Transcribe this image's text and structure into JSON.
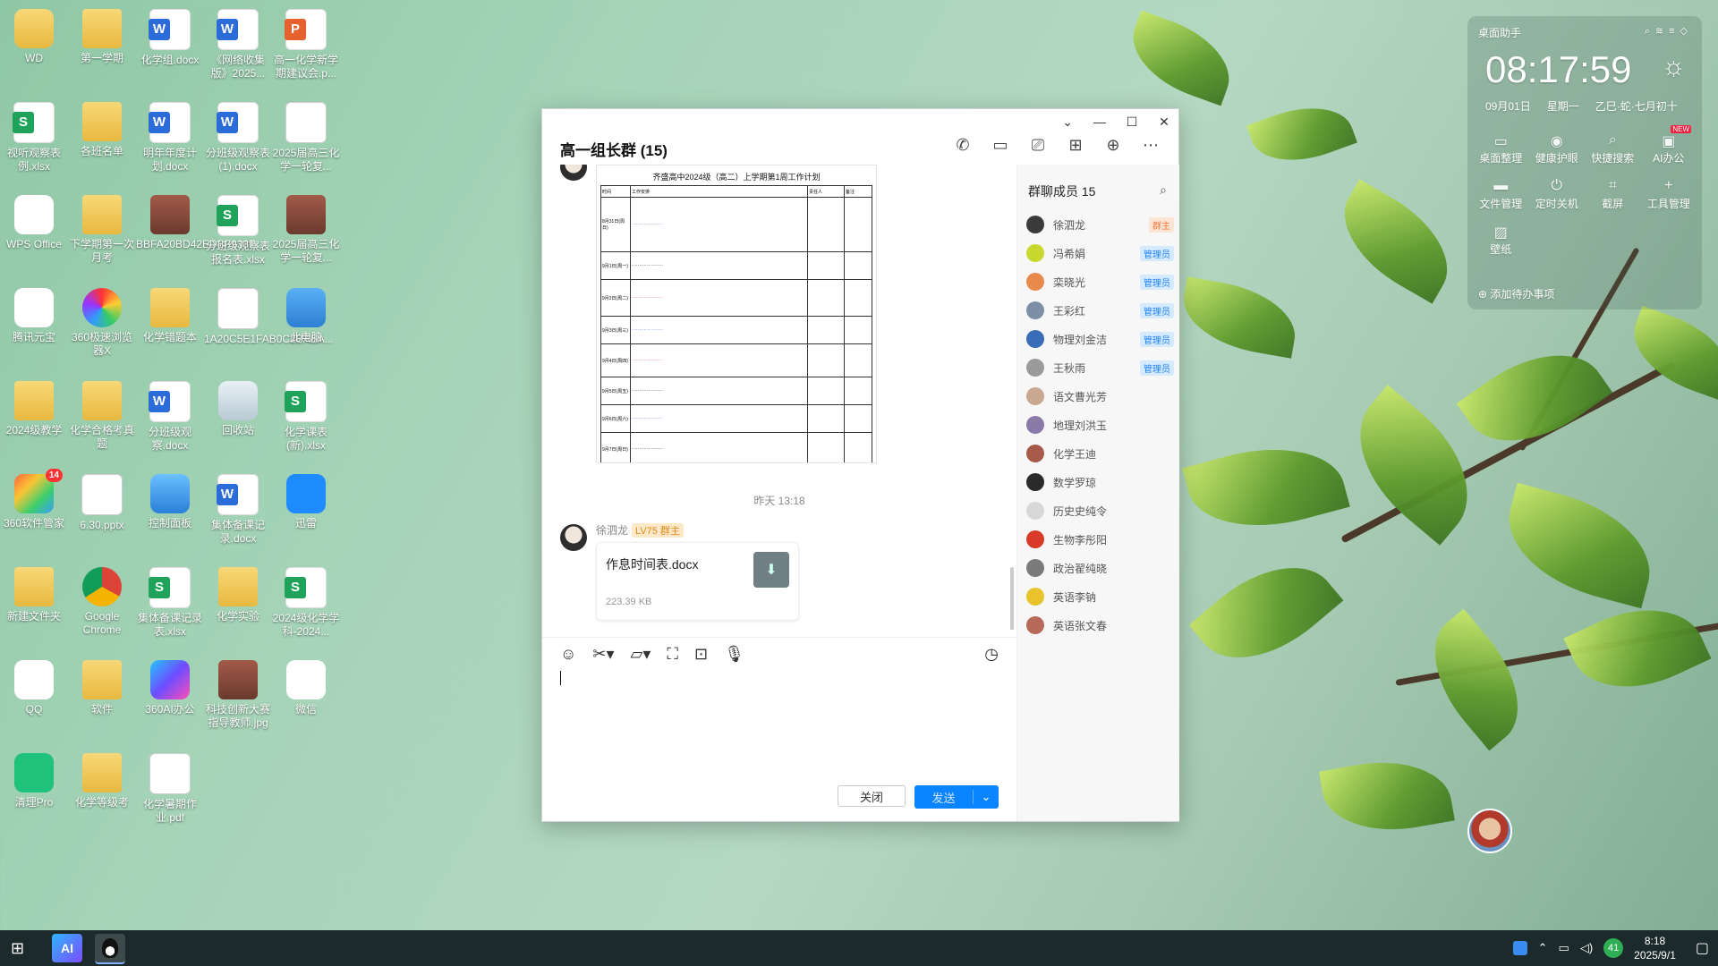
{
  "desktop": {
    "icons": [
      {
        "label": "WD",
        "kind": "user"
      },
      {
        "label": "第一学期",
        "kind": "folder"
      },
      {
        "label": "化学组.docx",
        "kind": "word"
      },
      {
        "label": "《网络收集版》2025...",
        "kind": "word"
      },
      {
        "label": "高一化学新学期建议会.p...",
        "kind": "ppt"
      },
      {
        "label": "视听观察表例.xlsx",
        "kind": "excel"
      },
      {
        "label": "各班名单",
        "kind": "folder"
      },
      {
        "label": "明年年度计划.docx",
        "kind": "word"
      },
      {
        "label": "分班级观察表(1).docx",
        "kind": "word"
      },
      {
        "label": "2025届高三化学一轮复...",
        "kind": "doc"
      },
      {
        "label": "WPS Office",
        "kind": "wps"
      },
      {
        "label": "下学期第一次月考",
        "kind": "folder"
      },
      {
        "label": "BBFA20BD42EDBF933F...",
        "kind": "img"
      },
      {
        "label": "分班级观察表报名表.xlsx",
        "kind": "excel"
      },
      {
        "label": "2025届高三化学一轮复...",
        "kind": "img"
      },
      {
        "label": "腾讯元宝",
        "kind": "yuanbao"
      },
      {
        "label": "360极速浏览器X",
        "kind": "browser360"
      },
      {
        "label": "化学错题本",
        "kind": "folder"
      },
      {
        "label": "1A20C5E1FAB0C2BAEA...",
        "kind": "doc"
      },
      {
        "label": "此电脑",
        "kind": "pc"
      },
      {
        "label": "2024级教学",
        "kind": "folder"
      },
      {
        "label": "化学合格考真题",
        "kind": "folder"
      },
      {
        "label": "分班级观察.docx",
        "kind": "word"
      },
      {
        "label": "回收站",
        "kind": "recycle"
      },
      {
        "label": "化学课表(新).xlsx",
        "kind": "excel"
      },
      {
        "label": "360软件管家",
        "kind": "soft360",
        "badge": "14"
      },
      {
        "label": "6.30.pptx",
        "kind": "doc"
      },
      {
        "label": "控制面板",
        "kind": "control"
      },
      {
        "label": "集体备课记录.docx",
        "kind": "word"
      },
      {
        "label": "迅雷",
        "kind": "xunlei"
      },
      {
        "label": "新建文件夹",
        "kind": "folder"
      },
      {
        "label": "Google Chrome",
        "kind": "chrome"
      },
      {
        "label": "集体备课记录表.xlsx",
        "kind": "excel"
      },
      {
        "label": "化学实验",
        "kind": "folder"
      },
      {
        "label": "2024级化学学科-2024...",
        "kind": "excel"
      },
      {
        "label": "QQ",
        "kind": "qq"
      },
      {
        "label": "软件",
        "kind": "folder"
      },
      {
        "label": "360AI办公",
        "kind": "ai360"
      },
      {
        "label": "科技创新大赛指导教师.jpg",
        "kind": "img"
      },
      {
        "label": "微信",
        "kind": "wechat"
      },
      {
        "label": "清理Pro",
        "kind": "cleanpro"
      },
      {
        "label": "化学等级考",
        "kind": "folder"
      },
      {
        "label": "化学暑期作业.pdf",
        "kind": "doc"
      }
    ]
  },
  "chat": {
    "window_controls": [
      "⌄",
      "—",
      "☐",
      "✕"
    ],
    "title": "高一组长群 (15)",
    "top_tools": [
      "phone-icon",
      "video-icon",
      "screen-share-icon",
      "apps-icon",
      "add-icon",
      "more-icon"
    ],
    "doc_preview": {
      "title": "齐盛高中2024级（高二）上学期第1周工作计划",
      "headers": [
        "时间",
        "工作安排",
        "责任人",
        "备注"
      ],
      "rows": [
        "8月31日(周日)",
        "9月1日(周一)",
        "9月2日(周二)",
        "9月3日(周三)",
        "9月4日(周四)",
        "9月5日(周五)",
        "9月6日(周六)",
        "9月7日(周日)"
      ]
    },
    "timestamp": "昨天 13:18",
    "sender": {
      "name": "徐泗龙",
      "level": "LV75 群主"
    },
    "file": {
      "name": "作息时间表.docx",
      "size": "223.39 KB"
    },
    "close_label": "关闭",
    "send_label": "发送",
    "members": {
      "title": "群聊成员",
      "count": "15",
      "list": [
        {
          "name": "徐泗龙",
          "tag": "群主",
          "tag_type": "owner",
          "color": "#3a3a3a"
        },
        {
          "name": "冯希娟",
          "tag": "管理员",
          "tag_type": "admin",
          "color": "#c9d82e"
        },
        {
          "name": "栾晓光",
          "tag": "管理员",
          "tag_type": "admin",
          "color": "#e88a4c"
        },
        {
          "name": "王彩红",
          "tag": "管理员",
          "tag_type": "admin",
          "color": "#7d8fa6"
        },
        {
          "name": "物理刘金洁",
          "tag": "管理员",
          "tag_type": "admin",
          "color": "#3a6db8"
        },
        {
          "name": "王秋雨",
          "tag": "管理员",
          "tag_type": "admin",
          "color": "#9a9a9a"
        },
        {
          "name": "语文曹光芳",
          "tag": "",
          "tag_type": "",
          "color": "#c8a890"
        },
        {
          "name": "地理刘洪玉",
          "tag": "",
          "tag_type": "",
          "color": "#8a7aa8"
        },
        {
          "name": "化学王迪",
          "tag": "",
          "tag_type": "",
          "color": "#a85a4a"
        },
        {
          "name": "数学罗琼",
          "tag": "",
          "tag_type": "",
          "color": "#2a2a2a"
        },
        {
          "name": "历史史纯令",
          "tag": "",
          "tag_type": "",
          "color": "#d8d8d8"
        },
        {
          "name": "生物李彤阳",
          "tag": "",
          "tag_type": "",
          "color": "#d83a2a"
        },
        {
          "name": "政治翟纯晓",
          "tag": "",
          "tag_type": "",
          "color": "#7a7a7a"
        },
        {
          "name": "英语李钠",
          "tag": "",
          "tag_type": "",
          "color": "#e8c32a"
        },
        {
          "name": "英语张文春",
          "tag": "",
          "tag_type": "",
          "color": "#b86a5a"
        }
      ]
    }
  },
  "widget": {
    "title": "桌面助手",
    "time": "08:17:59",
    "date": "09月01日",
    "weekday": "星期一",
    "lunar": "乙巳·蛇·七月初十",
    "items": [
      {
        "label": "桌面整理",
        "new": false
      },
      {
        "label": "健康护眼",
        "new": false
      },
      {
        "label": "快捷搜索",
        "new": false
      },
      {
        "label": "AI办公",
        "new": true
      },
      {
        "label": "文件管理",
        "new": false
      },
      {
        "label": "定时关机",
        "new": false
      },
      {
        "label": "截屏",
        "new": false
      },
      {
        "label": "工具管理",
        "new": false
      },
      {
        "label": "壁纸",
        "new": false
      }
    ],
    "new_label": "NEW",
    "todo": "添加待办事项"
  },
  "taskbar": {
    "time": "8:18",
    "date": "2025/9/1",
    "temp": "41",
    "ai_label": "AI"
  }
}
